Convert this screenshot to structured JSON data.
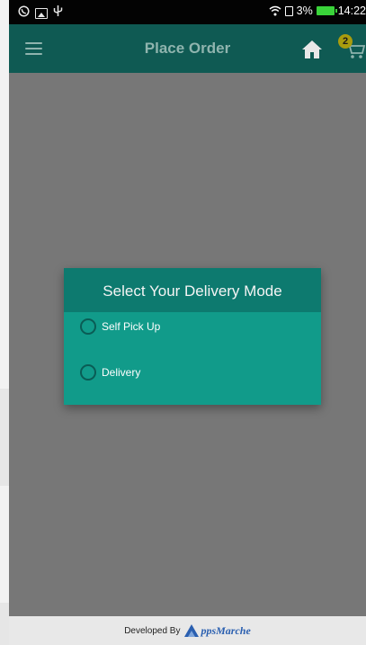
{
  "status_bar": {
    "battery_percent": "3%",
    "time": "14:22",
    "icons": [
      "whatsapp-icon",
      "gallery-icon",
      "usb-icon",
      "wifi-icon",
      "sim-icon",
      "battery-icon"
    ]
  },
  "app_bar": {
    "title": "Place Order",
    "cart_count": "2",
    "icons": [
      "menu-icon",
      "home-icon",
      "cart-icon"
    ]
  },
  "dialog": {
    "title": "Select Your Delivery Mode",
    "options": [
      {
        "label": "Self Pick Up",
        "selected": false
      },
      {
        "label": "Delivery",
        "selected": false
      }
    ]
  },
  "footer": {
    "developed_by": "Developed By",
    "brand": "ppsMarche",
    "brand_color": "#2a5fb0"
  },
  "colors": {
    "app_bar": "#0f5a53",
    "dialog_header": "#0d7a6f",
    "dialog_body": "#119b8a",
    "overlay": "#777777"
  }
}
